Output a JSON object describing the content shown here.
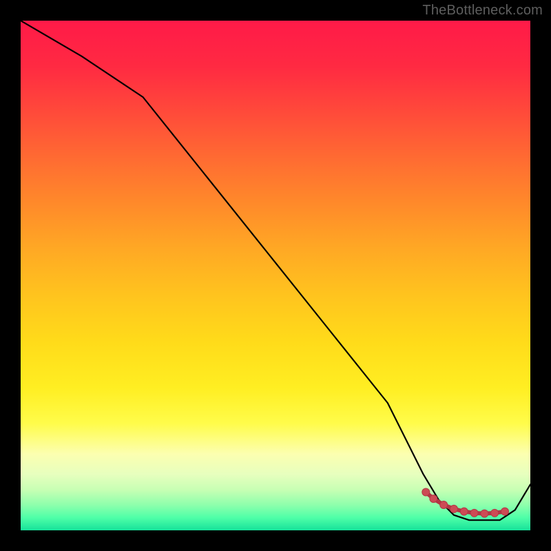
{
  "watermark": "TheBottleneck.com",
  "chart_data": {
    "type": "line",
    "title": "",
    "xlabel": "",
    "ylabel": "",
    "xlim": [
      0,
      100
    ],
    "ylim": [
      0,
      100
    ],
    "grid": false,
    "legend": false,
    "gradient_stops": [
      {
        "pos": 0,
        "color": "#ff1a48"
      },
      {
        "pos": 9,
        "color": "#ff2a42"
      },
      {
        "pos": 18,
        "color": "#ff4a3a"
      },
      {
        "pos": 27,
        "color": "#ff6b32"
      },
      {
        "pos": 36,
        "color": "#ff8a2a"
      },
      {
        "pos": 45,
        "color": "#ffa924"
      },
      {
        "pos": 54,
        "color": "#ffc41e"
      },
      {
        "pos": 63,
        "color": "#ffdb1a"
      },
      {
        "pos": 72,
        "color": "#ffee22"
      },
      {
        "pos": 79,
        "color": "#fffc4a"
      },
      {
        "pos": 85,
        "color": "#fcffb0"
      },
      {
        "pos": 89,
        "color": "#e7ffbe"
      },
      {
        "pos": 92,
        "color": "#c8ffb4"
      },
      {
        "pos": 95,
        "color": "#8effac"
      },
      {
        "pos": 97.5,
        "color": "#4fffa8"
      },
      {
        "pos": 100,
        "color": "#16e29a"
      }
    ],
    "series": [
      {
        "name": "bottleneck-curve",
        "color": "#000000",
        "x": [
          0,
          12,
          24,
          36,
          48,
          60,
          72,
          79,
          82,
          85,
          88,
          91,
          94,
          97,
          100
        ],
        "values": [
          100,
          93,
          85,
          70,
          55,
          40,
          25,
          11,
          6,
          3,
          2,
          2,
          2,
          4,
          9
        ]
      }
    ],
    "markers": {
      "name": "highlight-nodes",
      "color": "#cc4b55",
      "stroke": "#b23744",
      "x": [
        79.5,
        81,
        83,
        85,
        87,
        89,
        91,
        93,
        95
      ],
      "values": [
        7.5,
        6.2,
        5.0,
        4.2,
        3.7,
        3.4,
        3.3,
        3.4,
        3.7
      ]
    }
  }
}
